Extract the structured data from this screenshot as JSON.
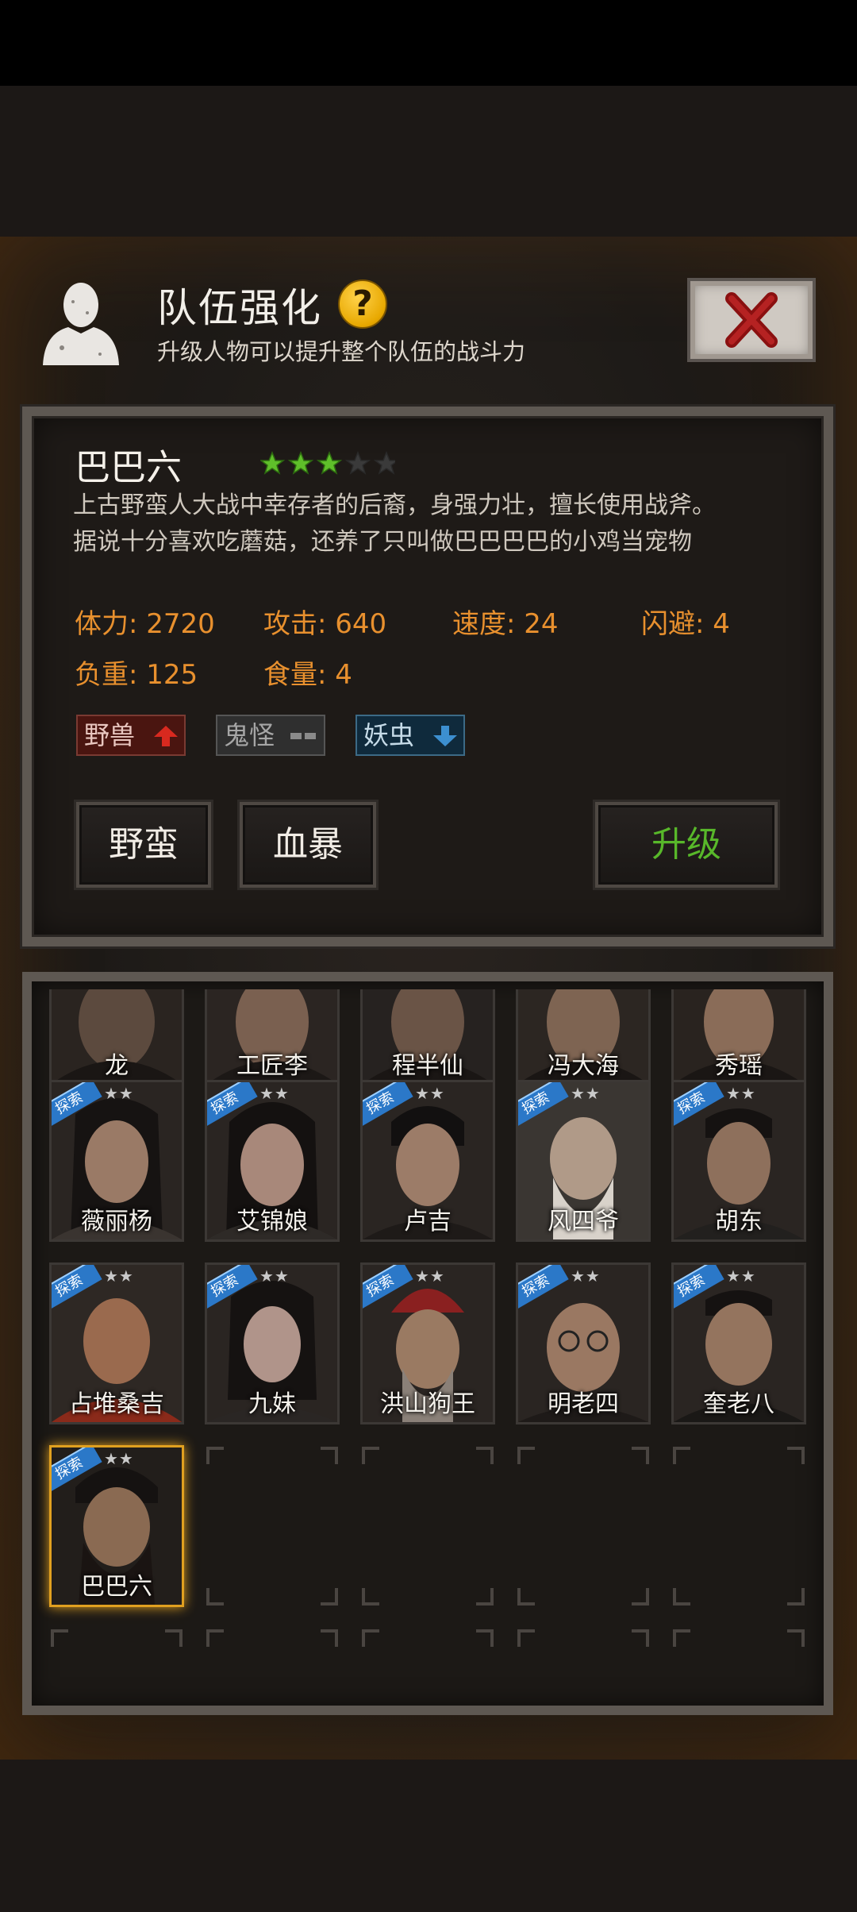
{
  "header": {
    "title": "队伍强化",
    "subtitle": "升级人物可以提升整个队伍的战斗力",
    "help_glyph": "?"
  },
  "selected": {
    "name": "巴巴六",
    "stars_filled": 3,
    "stars_total": 5,
    "description_line1": "上古野蛮人大战中幸存者的后裔，身强力壮，擅长使用战斧。",
    "description_line2": "据说十分喜欢吃蘑菇，还养了只叫做巴巴巴巴的小鸡当宠物",
    "stats": {
      "stamina": "体力: 2720",
      "attack": "攻击: 640",
      "speed": "速度: 24",
      "dodge": "闪避: 4",
      "load": "负重: 125",
      "food": "食量: 4"
    },
    "tags": {
      "beast": "野兽",
      "ghost": "鬼怪",
      "bug": "妖虫"
    },
    "skill1": "野蛮",
    "skill2": "血暴",
    "upgrade": "升级"
  },
  "badge_text": "探索",
  "star_glyphs": "★★",
  "roster": {
    "row0": [
      "龙",
      "工匠李",
      "程半仙",
      "冯大海",
      "秀瑶"
    ],
    "row1": [
      "薇丽杨",
      "艾锦娘",
      "卢吉",
      "风四爷",
      "胡东"
    ],
    "row2": [
      "占堆桑吉",
      "九妹",
      "洪山狗王",
      "明老四",
      "奎老八"
    ],
    "row3": [
      "巴巴六"
    ]
  },
  "colors": {
    "stat_orange": "#e8902e",
    "upgrade_green": "#58b82a",
    "selected_border": "#e0a020",
    "badge_blue": "#2b78c8"
  }
}
